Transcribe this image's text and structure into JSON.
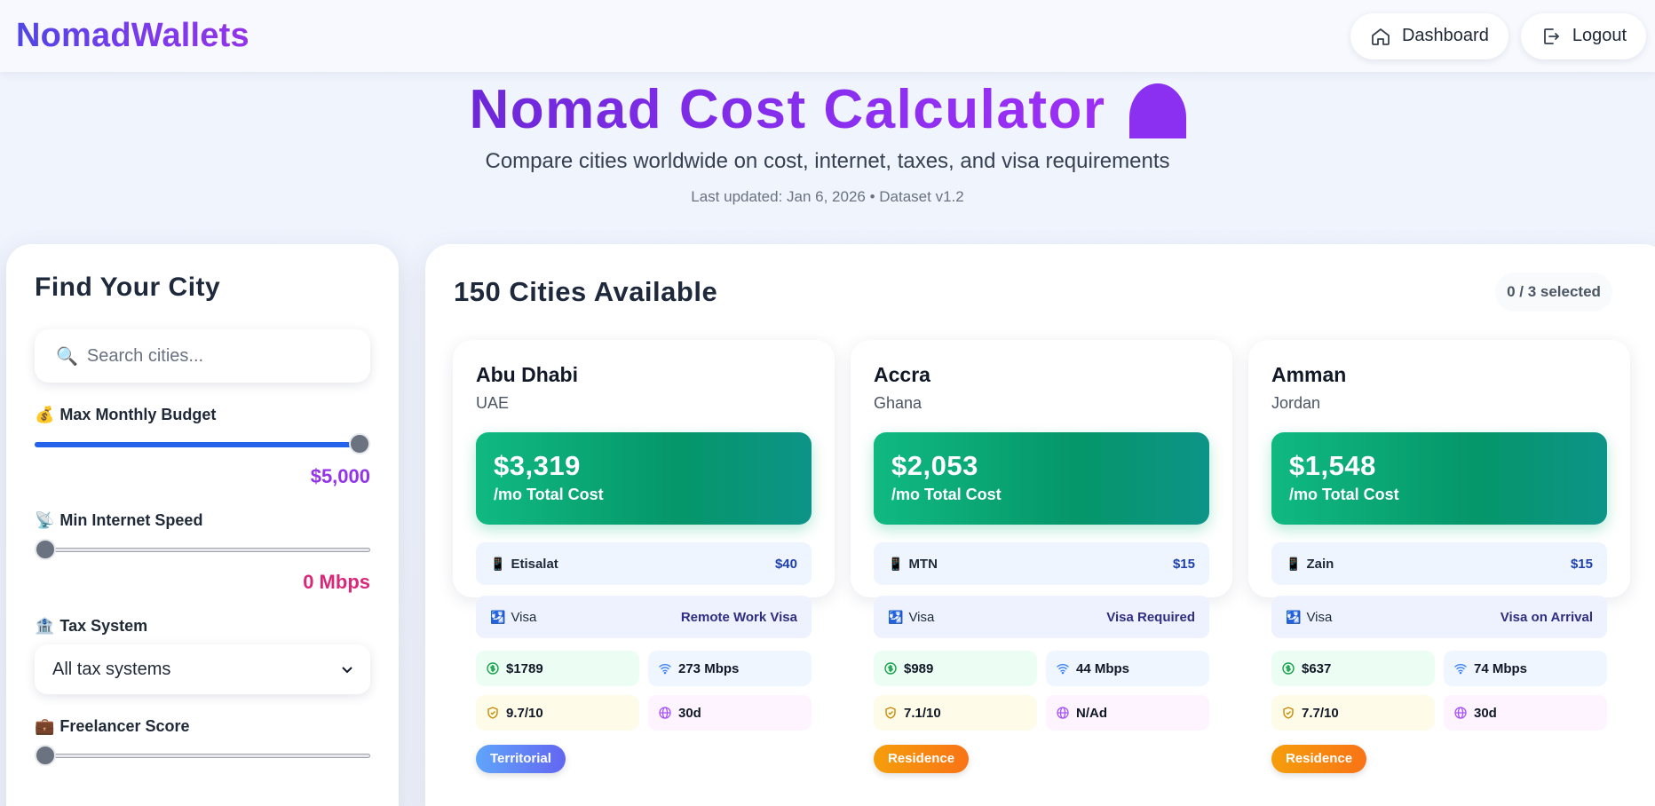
{
  "header": {
    "logo": "NomadWallets",
    "nav": [
      {
        "label": "Dashboard",
        "icon": "home-icon"
      },
      {
        "label": "Logout",
        "icon": "logout-icon"
      }
    ]
  },
  "hero": {
    "title": "Nomad Cost Calculator",
    "subtitle": "Compare cities worldwide on cost, internet, taxes, and visa requirements",
    "meta": "Last updated: Jan 6, 2026 • Dataset v1.2"
  },
  "filters": {
    "title": "Find Your City",
    "search_placeholder": "Search cities...",
    "budget": {
      "label": "Max Monthly Budget",
      "emoji": "💰",
      "value_text": "$5,000",
      "fraction": 1.0,
      "color": "#9333ea"
    },
    "internet": {
      "label": "Min Internet Speed",
      "emoji": "📡",
      "value_text": "0 Mbps",
      "fraction": 0.0,
      "color": "#db2777"
    },
    "tax": {
      "label": "Tax System",
      "emoji": "🏦",
      "selected": "All tax systems"
    },
    "freelancer": {
      "label": "Freelancer Score",
      "emoji": "💼",
      "fraction": 0.0
    }
  },
  "results": {
    "title": "150 Cities Available",
    "selected": "0 / 3 selected",
    "visa_label": "Visa",
    "cost_label": "/mo Total Cost",
    "cities": [
      {
        "name": "Abu Dhabi",
        "country": "UAE",
        "cost": "$3,319",
        "provider": "Etisalat",
        "provider_price": "$40",
        "visa": "Remote Work Visa",
        "rent": "$1789",
        "internet": "273 Mbps",
        "safety": "9.7/10",
        "stay": "30d",
        "tag": "Territorial",
        "tag_style": "territorial"
      },
      {
        "name": "Accra",
        "country": "Ghana",
        "cost": "$2,053",
        "provider": "MTN",
        "provider_price": "$15",
        "visa": "Visa Required",
        "rent": "$989",
        "internet": "44 Mbps",
        "safety": "7.1/10",
        "stay": "N/Ad",
        "tag": "Residence",
        "tag_style": "residence"
      },
      {
        "name": "Amman",
        "country": "Jordan",
        "cost": "$1,548",
        "provider": "Zain",
        "provider_price": "$15",
        "visa": "Visa on Arrival",
        "rent": "$637",
        "internet": "74 Mbps",
        "safety": "7.7/10",
        "stay": "30d",
        "tag": "Residence",
        "tag_style": "residence"
      }
    ]
  }
}
